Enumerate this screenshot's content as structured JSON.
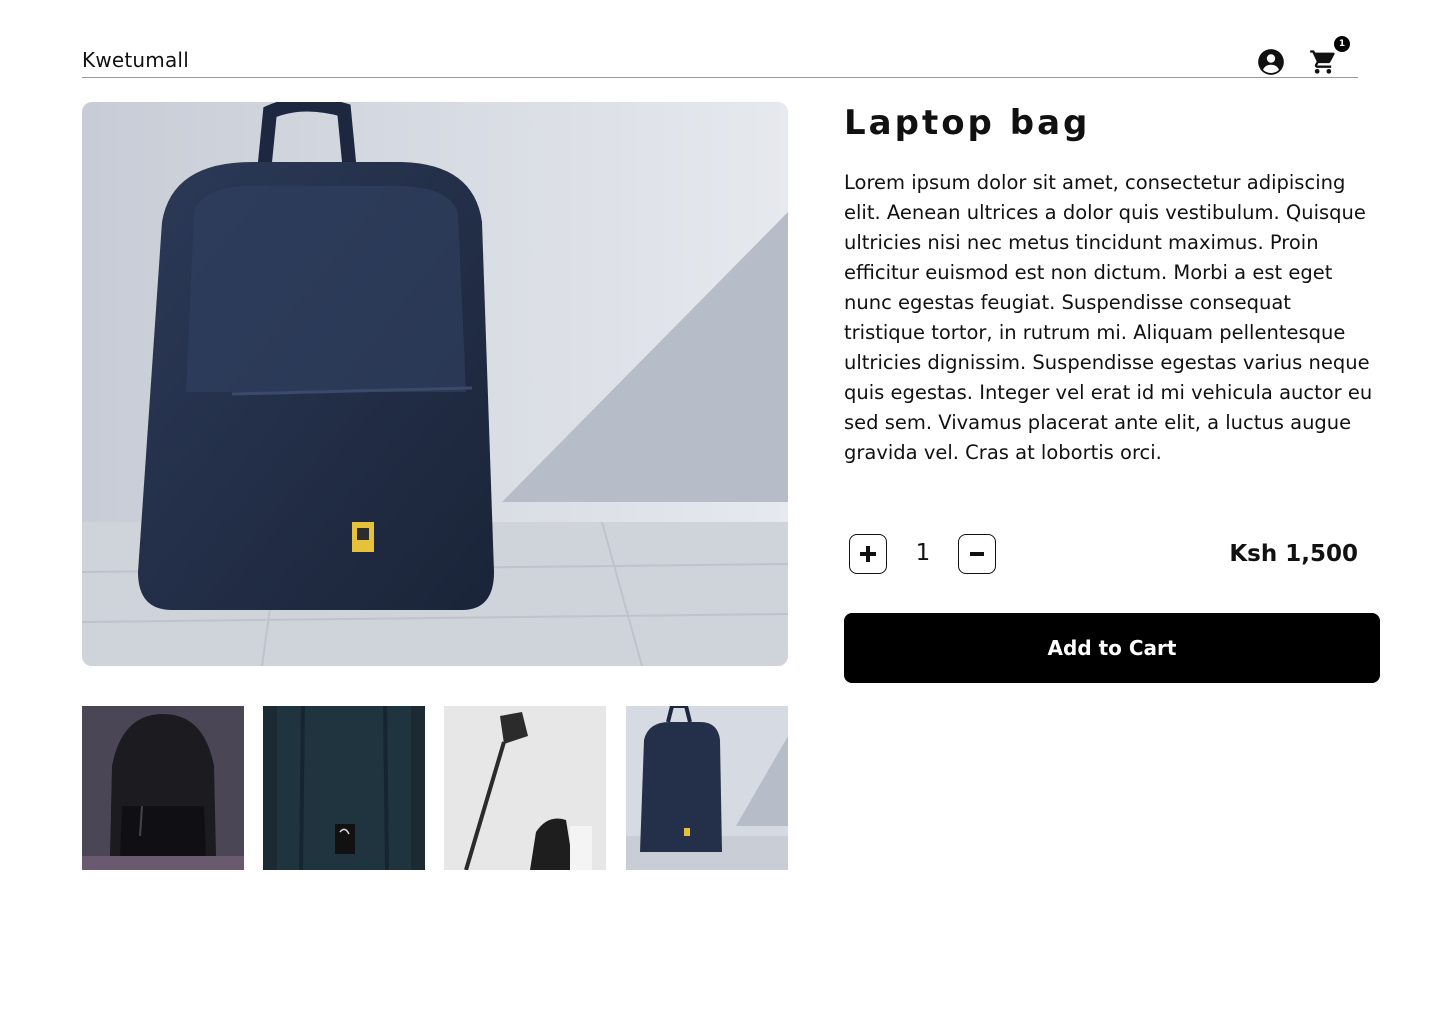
{
  "header": {
    "brand": "Kwetumall",
    "account_icon": "account-circle-icon",
    "cart_icon": "shopping-cart-icon",
    "cart_count": "1"
  },
  "product": {
    "title": "Laptop bag",
    "description": "Lorem ipsum dolor sit amet, consectetur adipiscing elit. Aenean ultrices a dolor quis vestibulum. Quisque ultricies nisi nec metus tincidunt maximus. Proin efficitur euismod est non dictum. Morbi a est eget nunc egestas feugiat. Suspendisse consequat tristique tortor, in rutrum mi. Aliquam pellentesque ultricies dignissim. Suspendisse egestas varius neque quis egestas. Integer vel erat id mi vehicula auctor eu sed sem. Vivamus placerat ante elit, a luctus augue gravida vel. Cras at lobortis orci.",
    "quantity": "1",
    "price": "Ksh 1,500",
    "add_to_cart_label": "Add to Cart",
    "increment_icon": "plus-icon",
    "decrement_icon": "minus-icon"
  },
  "gallery": {
    "main_image": "navy-backpack-photo",
    "thumbnails": [
      "black-backpack-photo",
      "teal-backpack-photo",
      "floor-lamp-with-bag-photo",
      "navy-backpack-photo"
    ]
  },
  "colors": {
    "accent": "#000000",
    "background": "#ffffff"
  }
}
